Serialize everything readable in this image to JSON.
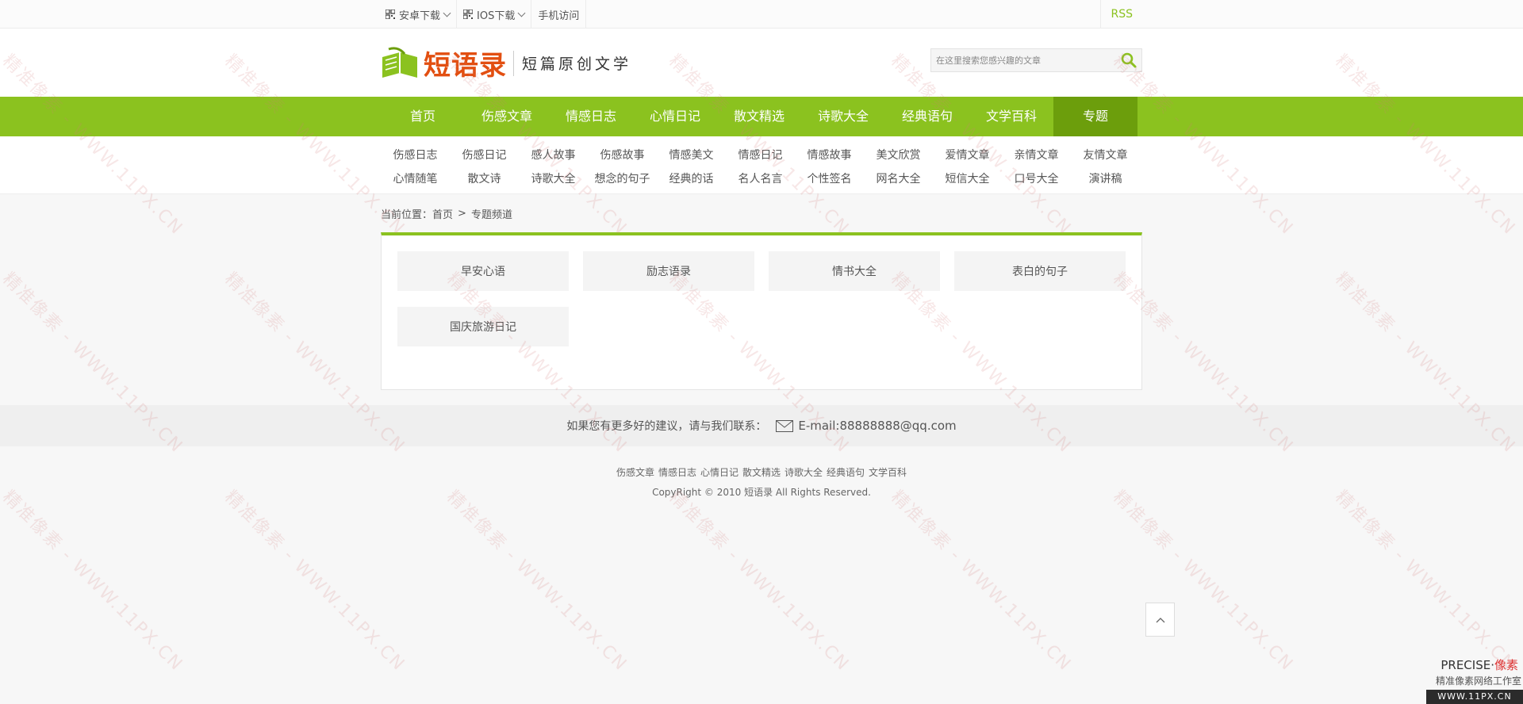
{
  "topbar": {
    "android": "安卓下载",
    "ios": "IOS下载",
    "mobile": "手机访问",
    "rss": "RSS"
  },
  "header": {
    "logo_text": "短语录",
    "logo_sub": "短篇原创文学",
    "search_placeholder": "在这里搜索您感兴趣的文章"
  },
  "nav": [
    {
      "label": "首页"
    },
    {
      "label": "伤感文章"
    },
    {
      "label": "情感日志"
    },
    {
      "label": "心情日记"
    },
    {
      "label": "散文精选"
    },
    {
      "label": "诗歌大全"
    },
    {
      "label": "经典语句"
    },
    {
      "label": "文学百科"
    },
    {
      "label": "专题",
      "active": true
    }
  ],
  "subnav": {
    "row1": [
      "伤感日志",
      "伤感日记",
      "感人故事",
      "伤感故事",
      "情感美文",
      "情感日记",
      "情感故事",
      "美文欣赏",
      "爱情文章",
      "亲情文章",
      "友情文章"
    ],
    "row2": [
      "心情随笔",
      "散文诗",
      "诗歌大全",
      "想念的句子",
      "经典的话",
      "名人名言",
      "个性签名",
      "网名大全",
      "短信大全",
      "口号大全",
      "演讲稿"
    ]
  },
  "breadcrumb": {
    "prefix": "当前位置：",
    "home": "首页",
    "separator": ">",
    "current": "专题频道"
  },
  "topics": [
    "早安心语",
    "励志语录",
    "情书大全",
    "表白的句子",
    "国庆旅游日记"
  ],
  "contact": {
    "text": "如果您有更多好的建议，请与我们联系：",
    "email": "E-mail:88888888@qq.com"
  },
  "footer": {
    "links": [
      "伤感文章",
      "情感日志",
      "心情日记",
      "散文精选",
      "诗歌大全",
      "经典语句",
      "文学百科"
    ],
    "copyright": "CopyRight © 2010 短语录 All Rights Reserved."
  },
  "watermark": {
    "text": "精准像素 - WWW.11PX.CN"
  },
  "corner": {
    "brand_a": "PRECISE·",
    "brand_b": "像素",
    "studio": "精准像素网络工作室",
    "url": "WWW.11PX.CN"
  },
  "colors": {
    "accent": "#8bc21f",
    "accent_dark": "#6c9e0c",
    "logo": "#e24f11"
  },
  "icons": {
    "qr": "qr-code-icon",
    "search": "search-icon",
    "mail": "mail-icon",
    "back_top": "chevron-up-icon",
    "logo": "open-book-icon"
  }
}
